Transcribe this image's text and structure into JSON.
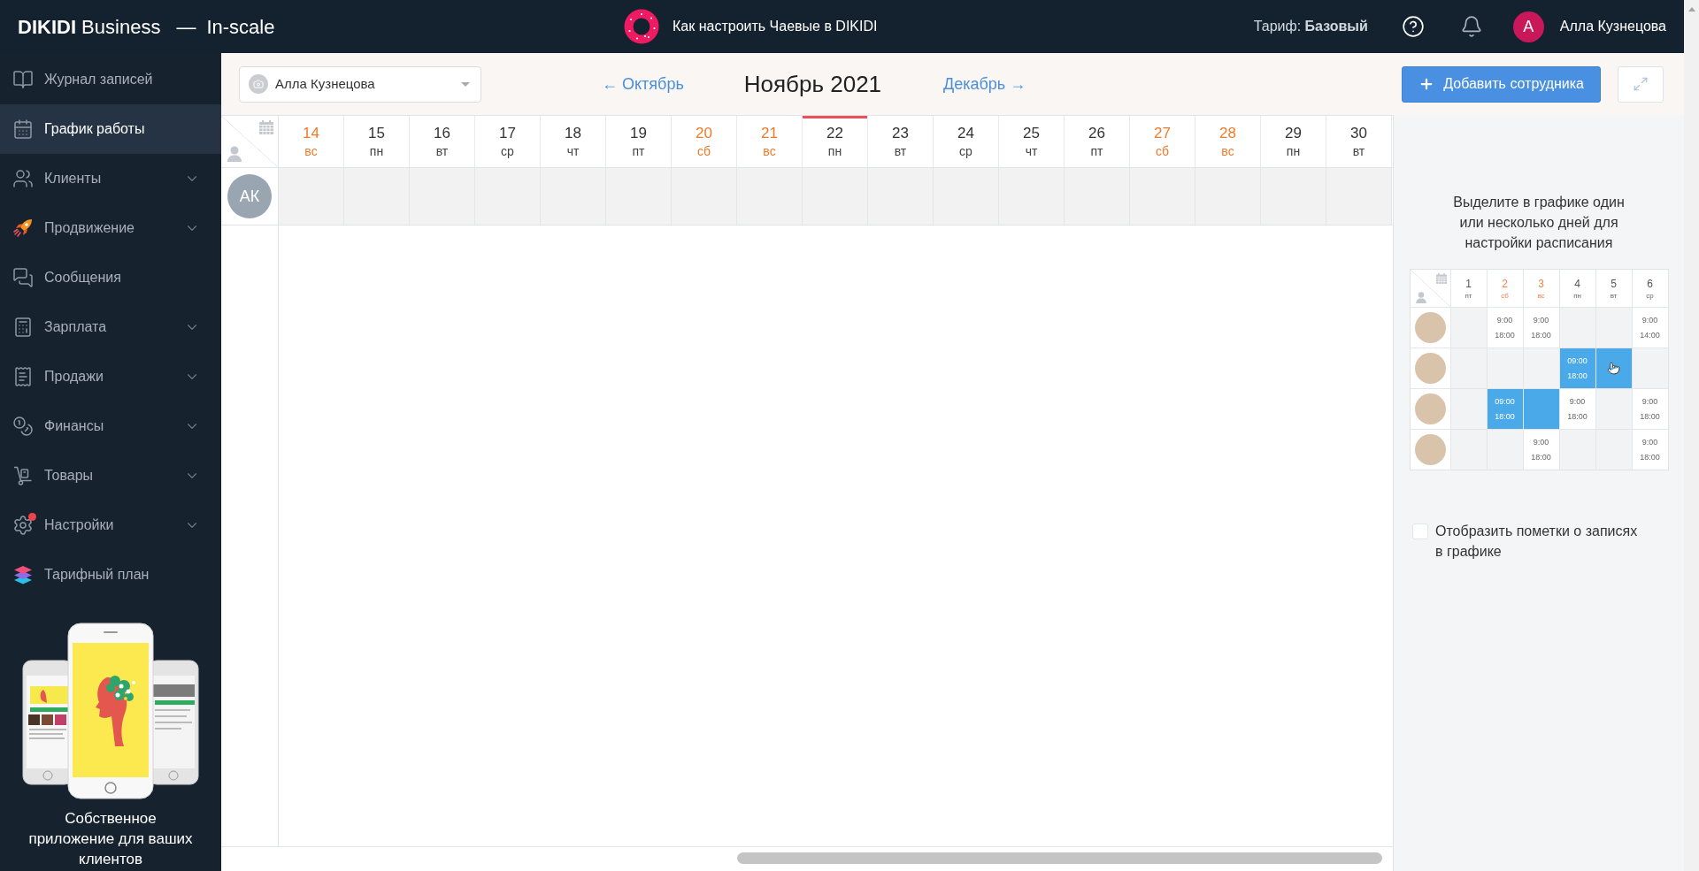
{
  "header": {
    "brand": "**DIKIDI** Business",
    "separator": "—",
    "company": "In-scale",
    "promo": "Как настроить Чаевые в DIKIDI",
    "tariff": "Тариф: **Базовый**",
    "user_initial": "А",
    "user_name": "Алла Кузнецова"
  },
  "sidebar": {
    "items": [
      {
        "label": "Журнал записей",
        "selected": false,
        "expandable": false,
        "notification": false
      },
      {
        "label": "График работы",
        "selected": true,
        "expandable": false,
        "notification": false
      },
      {
        "label": "Клиенты",
        "selected": false,
        "expandable": true,
        "notification": false
      },
      {
        "label": "Продвижение",
        "selected": false,
        "expandable": true,
        "notification": false
      },
      {
        "label": "Сообщения",
        "selected": false,
        "expandable": false,
        "notification": false
      },
      {
        "label": "Зарплата",
        "selected": false,
        "expandable": true,
        "notification": false
      },
      {
        "label": "Продажи",
        "selected": false,
        "expandable": true,
        "notification": false
      },
      {
        "label": "Финансы",
        "selected": false,
        "expandable": true,
        "notification": false
      },
      {
        "label": "Товары",
        "selected": false,
        "expandable": true,
        "notification": false
      },
      {
        "label": "Настройки",
        "selected": false,
        "expandable": true,
        "notification": true
      },
      {
        "label": "Тарифный план",
        "selected": false,
        "expandable": false,
        "notification": false
      }
    ],
    "app_promo": "Собственное приложение для ваших клиентов"
  },
  "toolbar": {
    "staff_select": "Алла Кузнецова",
    "prev_month": "← Октябрь",
    "month": "Ноябрь 2021",
    "next_month": "Декабрь →",
    "add_button": "Добавить сотрудника"
  },
  "schedule": {
    "days": [
      {
        "day": "14",
        "weekday": "вс",
        "weekend": true,
        "today": false
      },
      {
        "day": "15",
        "weekday": "пн",
        "weekend": false,
        "today": false
      },
      {
        "day": "16",
        "weekday": "вт",
        "weekend": false,
        "today": false
      },
      {
        "day": "17",
        "weekday": "ср",
        "weekend": false,
        "today": false
      },
      {
        "day": "18",
        "weekday": "чт",
        "weekend": false,
        "today": false
      },
      {
        "day": "19",
        "weekday": "пт",
        "weekend": false,
        "today": false
      },
      {
        "day": "20",
        "weekday": "сб",
        "weekend": true,
        "today": false
      },
      {
        "day": "21",
        "weekday": "вс",
        "weekend": true,
        "today": false
      },
      {
        "day": "22",
        "weekday": "пн",
        "weekend": false,
        "today": true
      },
      {
        "day": "23",
        "weekday": "вт",
        "weekend": false,
        "today": false
      },
      {
        "day": "24",
        "weekday": "ср",
        "weekend": false,
        "today": false
      },
      {
        "day": "25",
        "weekday": "чт",
        "weekend": false,
        "today": false
      },
      {
        "day": "26",
        "weekday": "пт",
        "weekend": false,
        "today": false
      },
      {
        "day": "27",
        "weekday": "сб",
        "weekend": true,
        "today": false
      },
      {
        "day": "28",
        "weekday": "вс",
        "weekend": true,
        "today": false
      },
      {
        "day": "29",
        "weekday": "пн",
        "weekend": false,
        "today": false
      },
      {
        "day": "30",
        "weekday": "вт",
        "weekend": false,
        "today": false
      }
    ],
    "staff": [
      {
        "initials": "АК"
      }
    ]
  },
  "help_panel": {
    "hint": "Выделите в графике один или несколько дней для настройки расписания",
    "example": {
      "days": [
        {
          "day": "1",
          "weekday": "пт",
          "weekend": false
        },
        {
          "day": "2",
          "weekday": "сб",
          "weekend": true
        },
        {
          "day": "3",
          "weekday": "вс",
          "weekend": true
        },
        {
          "day": "4",
          "weekday": "пн",
          "weekend": false
        },
        {
          "day": "5",
          "weekday": "вт",
          "weekend": false
        },
        {
          "day": "6",
          "weekday": "ср",
          "weekend": false
        }
      ],
      "rows": [
        {
          "cells": [
            {
              "selected": false,
              "cursor": false
            },
            {
              "start": "9:00",
              "end": "18:00",
              "selected": false,
              "cursor": false
            },
            {
              "start": "9:00",
              "end": "18:00",
              "selected": false,
              "cursor": false
            },
            {
              "selected": false,
              "cursor": false
            },
            {
              "selected": false,
              "cursor": false
            },
            {
              "start": "9:00",
              "end": "14:00",
              "selected": false,
              "cursor": false
            }
          ]
        },
        {
          "cells": [
            {
              "selected": false,
              "cursor": false
            },
            {
              "selected": false,
              "cursor": false
            },
            {
              "selected": false,
              "cursor": false
            },
            {
              "start": "09:00",
              "end": "18:00",
              "selected": true,
              "cursor": false
            },
            {
              "selected": true,
              "cursor": true
            },
            {
              "selected": false,
              "cursor": false
            }
          ]
        },
        {
          "cells": [
            {
              "selected": false,
              "cursor": false
            },
            {
              "start": "09:00",
              "end": "18:00",
              "selected": true,
              "cursor": false
            },
            {
              "selected": true,
              "cursor": false
            },
            {
              "start": "9:00",
              "end": "18:00",
              "selected": false,
              "cursor": false
            },
            {
              "selected": false,
              "cursor": false
            },
            {
              "start": "9:00",
              "end": "18:00",
              "selected": false,
              "cursor": false
            }
          ]
        },
        {
          "cells": [
            {
              "selected": false,
              "cursor": false
            },
            {
              "selected": false,
              "cursor": false
            },
            {
              "start": "9:00",
              "end": "18:00",
              "selected": false,
              "cursor": false
            },
            {
              "selected": false,
              "cursor": false
            },
            {
              "selected": false,
              "cursor": false
            },
            {
              "start": "9:00",
              "end": "18:00",
              "selected": false,
              "cursor": false
            }
          ]
        }
      ]
    },
    "checkbox": {
      "label": "Отобразить пометки о записях в графике",
      "checked": false
    }
  }
}
